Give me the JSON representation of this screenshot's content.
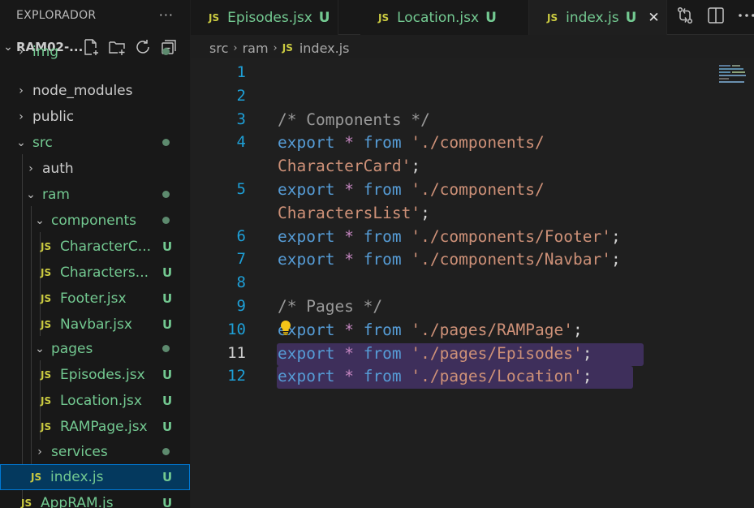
{
  "sidebar": {
    "title": "EXPLORADOR",
    "more": "···",
    "root_label": "RAM02-...",
    "items": [
      {
        "label": "img",
        "type": "folder",
        "status": "dot"
      },
      {
        "label": "node_modules",
        "type": "folder",
        "status": ""
      },
      {
        "label": "public",
        "type": "folder",
        "status": ""
      },
      {
        "label": "src",
        "type": "folder",
        "status": "dot"
      },
      {
        "label": "auth",
        "type": "folder",
        "status": ""
      },
      {
        "label": "ram",
        "type": "folder",
        "status": "dot"
      },
      {
        "label": "components",
        "type": "folder",
        "status": "dot"
      },
      {
        "label": "CharacterC...",
        "type": "file",
        "status": "U"
      },
      {
        "label": "Characters...",
        "type": "file",
        "status": "U"
      },
      {
        "label": "Footer.jsx",
        "type": "file",
        "status": "U"
      },
      {
        "label": "Navbar.jsx",
        "type": "file",
        "status": "U"
      },
      {
        "label": "pages",
        "type": "folder",
        "status": "dot"
      },
      {
        "label": "Episodes.jsx",
        "type": "file",
        "status": "U"
      },
      {
        "label": "Location.jsx",
        "type": "file",
        "status": "U"
      },
      {
        "label": "RAMPage.jsx",
        "type": "file",
        "status": "U"
      },
      {
        "label": "services",
        "type": "folder",
        "status": "dot"
      },
      {
        "label": "index.js",
        "type": "file",
        "status": "U"
      },
      {
        "label": "AppRAM.js",
        "type": "file",
        "status": "U"
      }
    ]
  },
  "file_badge": "JS",
  "untracked_badge": "U",
  "tabs": [
    {
      "label": "Episodes.jsx",
      "badge": "U"
    },
    {
      "label": "Location.jsx",
      "badge": "U"
    },
    {
      "label": "index.js",
      "badge": "U",
      "close": "✕"
    }
  ],
  "breadcrumb": {
    "seg1": "src",
    "seg2": "ram",
    "file": "index.js",
    "sep": "›"
  },
  "editor": {
    "line_numbers": [
      "1",
      "2",
      "3",
      "4",
      "5",
      "6",
      "7",
      "8",
      "9",
      "10",
      "11",
      "12"
    ],
    "tokens": {
      "export": "export",
      "star": "*",
      "from": "from",
      "semi": ";",
      "comment_components": "/* Components */",
      "comment_pages": "/* Pages */",
      "s4a": "'./components/",
      "s4b": "CharacterCard'",
      "s5a": "'./components/",
      "s5b": "CharactersList'",
      "s6": "'./components/Footer'",
      "s7": "'./components/Navbar'",
      "s10": "'./pages/RAMPage'",
      "s11": "'./pages/Episodes'",
      "s12": "'./pages/Location'"
    }
  },
  "colors": {
    "accent": "#0078d4",
    "untracked": "#73c991",
    "js_icon": "#cbcb41",
    "line_number": "#1e9fd6",
    "selection": "#3e2f5b"
  },
  "icons": [
    "new-file-icon",
    "new-folder-icon",
    "refresh-icon",
    "collapse-all-icon",
    "source-control-compare-icon",
    "split-editor-icon",
    "more-actions-icon",
    "lightbulb-icon"
  ]
}
